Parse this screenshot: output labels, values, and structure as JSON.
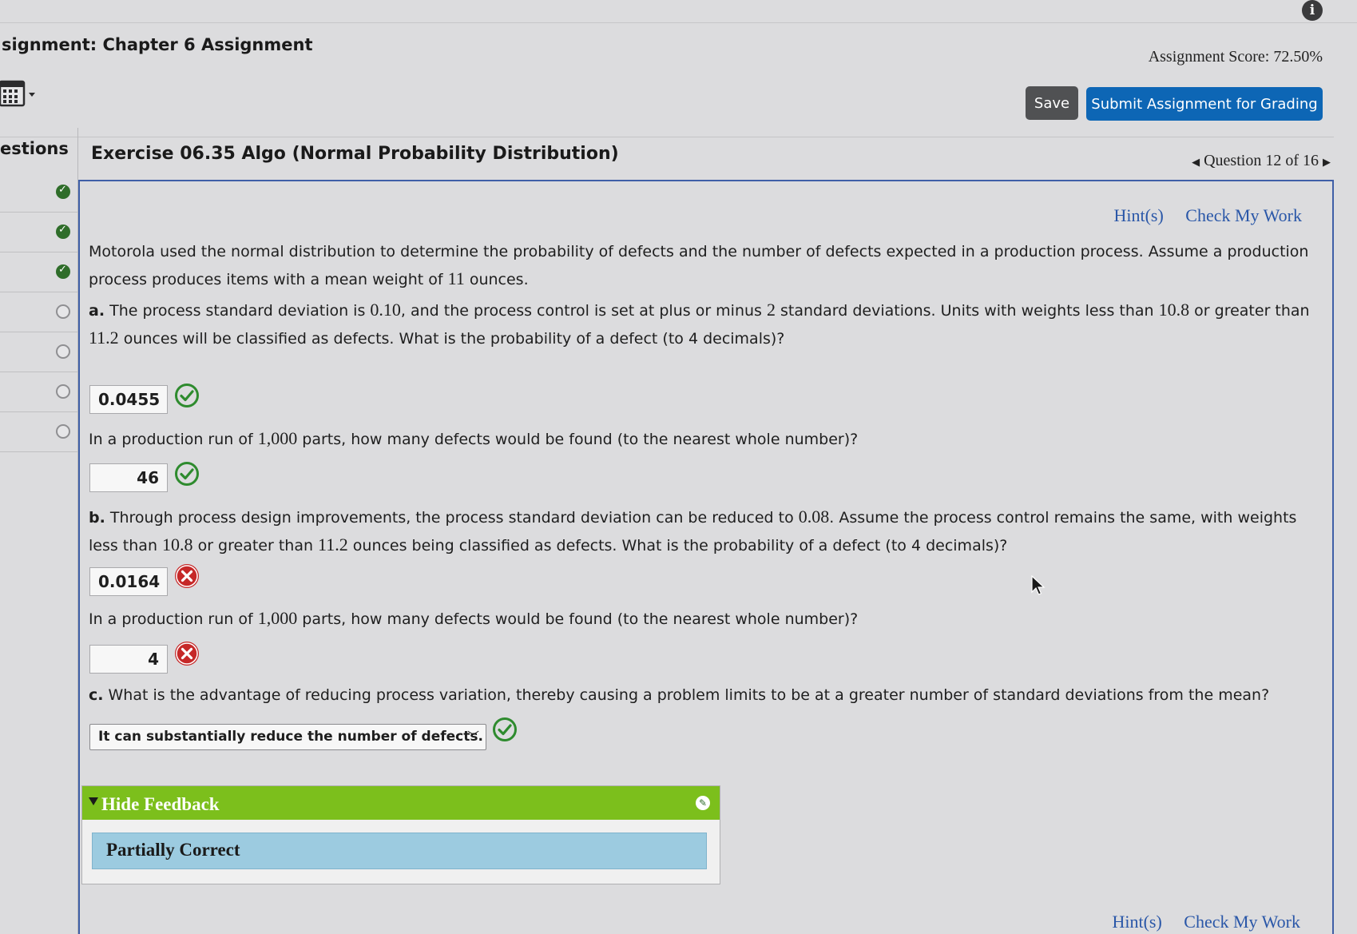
{
  "header": {
    "title": "signment: Chapter 6 Assignment",
    "score": "Assignment Score: 72.50%",
    "save_label": "Save",
    "submit_label": "Submit Assignment for Grading",
    "info_glyph": "i"
  },
  "sidebar": {
    "heading": "estions",
    "items": [
      {
        "status": "correct"
      },
      {
        "status": "correct"
      },
      {
        "status": "correct"
      },
      {
        "status": "unanswered"
      },
      {
        "status": "unanswered"
      },
      {
        "status": "unanswered"
      },
      {
        "status": "unanswered"
      }
    ]
  },
  "exercise": {
    "title": "Exercise 06.35 Algo (Normal Probability Distribution)",
    "nav_label": "Question 12 of 16",
    "hints_label": "Hint(s)",
    "check_label": "Check My Work"
  },
  "question": {
    "intro": {
      "t1": "Motorola used the normal distribution to determine the probability of defects and the number of defects expected in a production process. Assume a production process produces items with a mean weight of ",
      "n1": "11",
      "t2": " ounces."
    },
    "part_a": {
      "letter": "a.",
      "t1": " The process standard deviation is ",
      "n1": "0.10",
      "t2": ", and the process control is set at plus or minus ",
      "n2": "2",
      "t3": " standard deviations. Units with weights less than ",
      "n3": "10.8",
      "t4": " or greater than ",
      "n4": "11.2",
      "t5": " ounces will be classified as defects. What is the probability of a defect (to 4 decimals)?",
      "answer": "0.0455",
      "answer_status": "correct",
      "followup_t1": "In a production run of ",
      "followup_n1": "1,000",
      "followup_t2": " parts, how many defects would be found (to the nearest whole number)?",
      "followup_answer": "46",
      "followup_status": "correct"
    },
    "part_b": {
      "letter": "b.",
      "t1": " Through process design improvements, the process standard deviation can be reduced to ",
      "n1": "0.08",
      "t2": ". Assume the process control remains the same, with weights less than ",
      "n2": "10.8",
      "t3": " or greater than ",
      "n3": "11.2",
      "t4": " ounces being classified as defects. What is the probability of a defect (to 4 decimals)?",
      "answer": "0.0164",
      "answer_status": "incorrect",
      "followup_t1": "In a production run of ",
      "followup_n1": "1,000",
      "followup_t2": " parts, how many defects would be found (to the nearest whole number)?",
      "followup_answer": "4",
      "followup_status": "incorrect"
    },
    "part_c": {
      "letter": "c.",
      "text": " What is the advantage of reducing process variation, thereby causing a problem limits to be at a greater number of standard deviations from the mean?",
      "selected": "It can substantially reduce the number of defects.",
      "status": "correct"
    }
  },
  "feedback": {
    "toggle_label": "Hide Feedback",
    "status": "Partially Correct"
  },
  "colors": {
    "correct": "#2e8b2e",
    "incorrect": "#c62828",
    "submit_button": "#0d66b5",
    "feedback_header": "#7cbf1c",
    "feedback_body": "#9ccbe0",
    "link": "#2a57a8"
  }
}
